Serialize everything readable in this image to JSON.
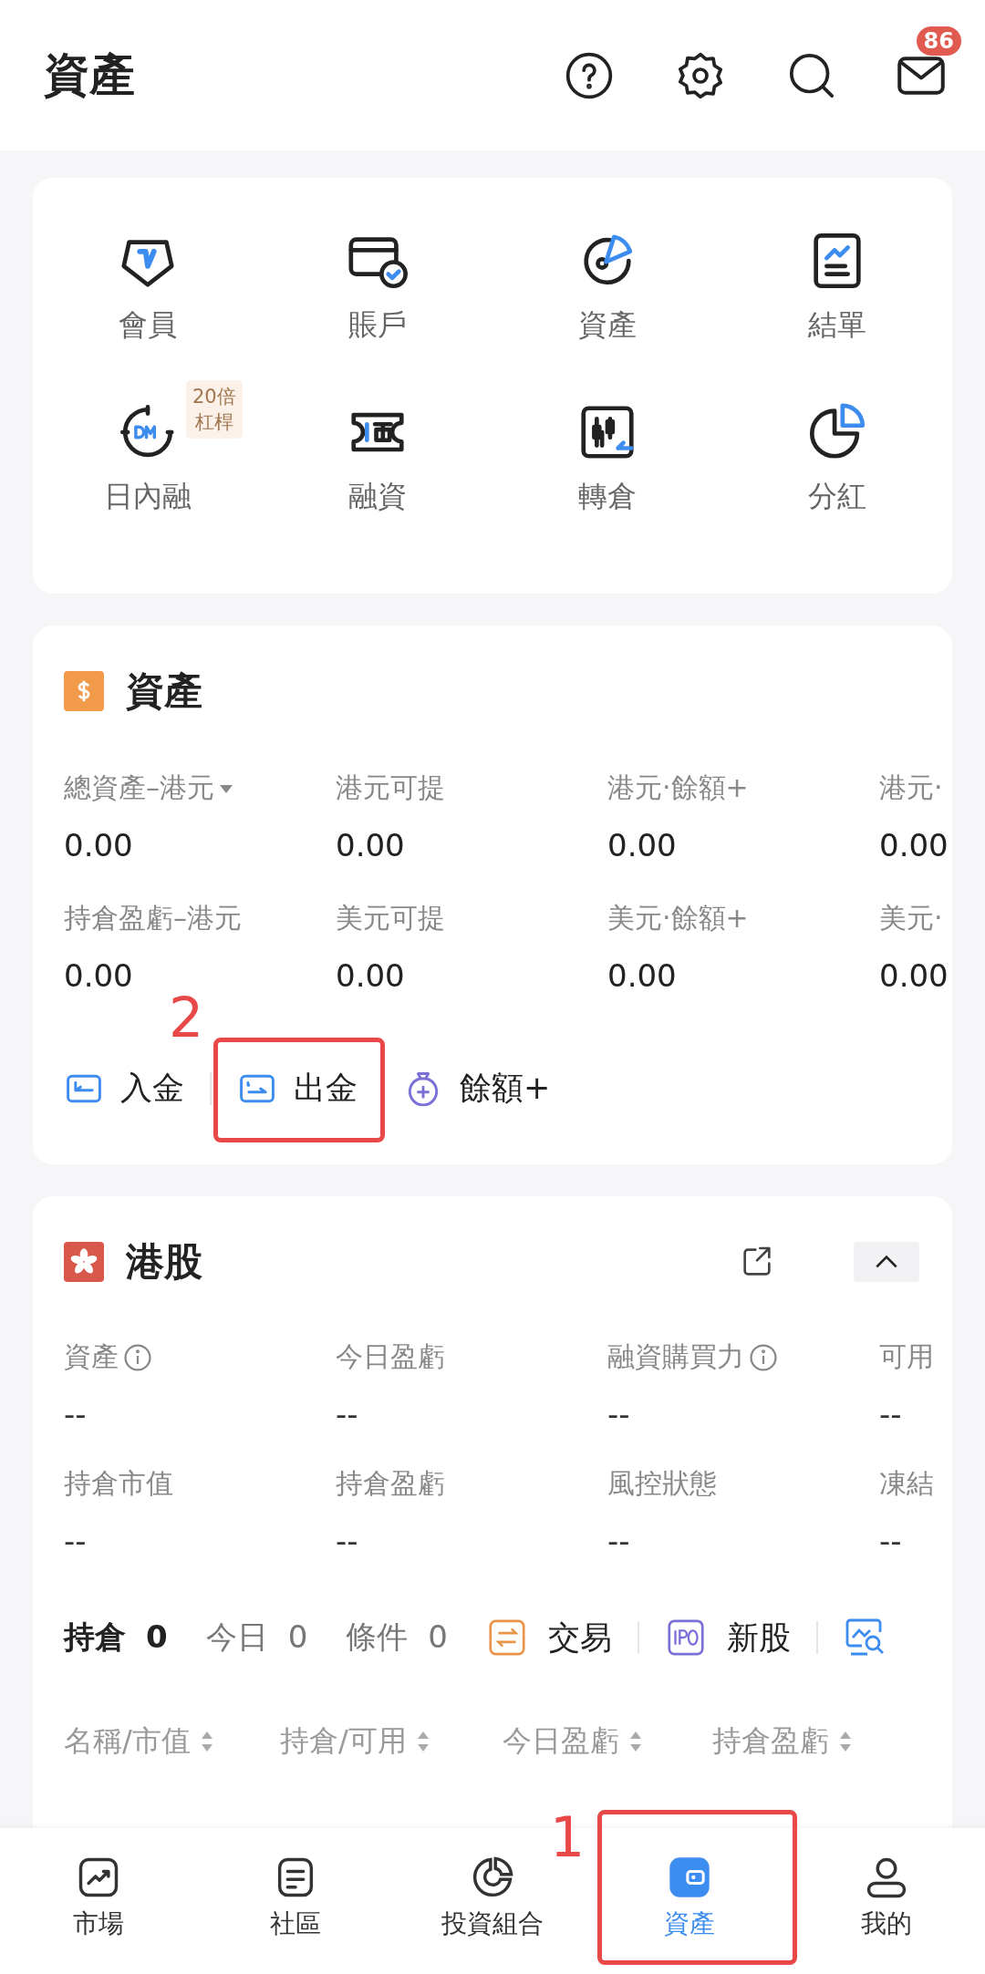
{
  "header": {
    "title": "資產",
    "mail_badge": "86"
  },
  "shortcuts": [
    {
      "label": "會員"
    },
    {
      "label": "賬戶"
    },
    {
      "label": "資產"
    },
    {
      "label": "結單"
    },
    {
      "label": "日內融",
      "tag": [
        "20倍",
        "杠桿"
      ]
    },
    {
      "label": "融資"
    },
    {
      "label": "轉倉"
    },
    {
      "label": "分紅"
    }
  ],
  "assets": {
    "title": "資產",
    "metrics": [
      {
        "label": "總資產–港元",
        "dropdown": true,
        "value": "0.00"
      },
      {
        "label": "港元可提",
        "dropdown": false,
        "value": "0.00"
      },
      {
        "label": "港元·餘額+",
        "dropdown": false,
        "value": "0.00"
      },
      {
        "label": "港元·",
        "dropdown": false,
        "value": "0.00"
      },
      {
        "label": "持倉盈虧–港元",
        "dropdown": false,
        "value": "0.00"
      },
      {
        "label": "美元可提",
        "dropdown": false,
        "value": "0.00"
      },
      {
        "label": "美元·餘額+",
        "dropdown": false,
        "value": "0.00"
      },
      {
        "label": "美元·",
        "dropdown": false,
        "value": "0.00"
      }
    ],
    "actions": [
      {
        "label": "入金"
      },
      {
        "label": "出金",
        "annotation": "2"
      },
      {
        "label": "餘額+"
      }
    ]
  },
  "hk_stocks": {
    "title": "港股",
    "metrics": [
      {
        "label": "資產",
        "info": true,
        "value": "--"
      },
      {
        "label": "今日盈虧",
        "info": false,
        "value": "--"
      },
      {
        "label": "融資購買力",
        "info": true,
        "value": "--"
      },
      {
        "label": "可用",
        "info": false,
        "value": "--"
      },
      {
        "label": "持倉市值",
        "info": false,
        "value": "--"
      },
      {
        "label": "持倉盈虧",
        "info": false,
        "value": "--"
      },
      {
        "label": "風控狀態",
        "info": false,
        "value": "--"
      },
      {
        "label": "凍結",
        "info": false,
        "value": "--"
      }
    ],
    "tabs": [
      {
        "label": "持倉",
        "count": "0",
        "selected": true
      },
      {
        "label": "今日",
        "count": "0",
        "selected": false
      },
      {
        "label": "條件",
        "count": "0",
        "selected": false
      }
    ],
    "tools": [
      {
        "label": "交易"
      },
      {
        "label": "新股"
      }
    ],
    "columns": [
      "名稱/市值",
      "持倉/可用",
      "今日盈虧",
      "持倉盈虧"
    ]
  },
  "nav": [
    {
      "label": "市場",
      "selected": false
    },
    {
      "label": "社區",
      "selected": false
    },
    {
      "label": "投資組合",
      "selected": false
    },
    {
      "label": "資產",
      "selected": true,
      "annotation": "1"
    },
    {
      "label": "我的",
      "selected": false
    }
  ]
}
